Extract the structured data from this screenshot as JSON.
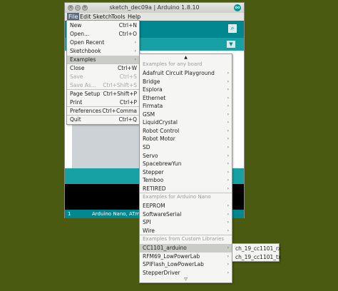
{
  "window": {
    "title": "sketch_dec09a | Arduino 1.8.10",
    "badge": "oo",
    "close_glyph": "×",
    "min_glyph": "-",
    "max_glyph": "+"
  },
  "menubar": [
    "File",
    "Edit",
    "Sketch",
    "Tools",
    "Help"
  ],
  "toolbar": {
    "serial_monitor_glyph": "⌕",
    "tab_menu_glyph": "▼"
  },
  "status": {
    "line": "1",
    "board": "Arduino Nano, ATmega..."
  },
  "file_menu": [
    {
      "label": "New",
      "shortcut": "Ctrl+N"
    },
    {
      "label": "Open...",
      "shortcut": "Ctrl+O"
    },
    {
      "label": "Open Recent",
      "arrow": "›"
    },
    {
      "label": "Sketchbook",
      "arrow": "›"
    },
    {
      "label": "Examples",
      "arrow": "›",
      "highlighted": true
    },
    {
      "label": "Close",
      "shortcut": "Ctrl+W"
    },
    {
      "label": "Save",
      "shortcut": "Ctrl+S",
      "disabled": true
    },
    {
      "label": "Save As...",
      "shortcut": "Ctrl+Shift+S",
      "disabled": true
    },
    {
      "label": "Page Setup",
      "shortcut": "Ctrl+Shift+P"
    },
    {
      "label": "Print",
      "shortcut": "Ctrl+P"
    },
    {
      "label": "Preferences",
      "shortcut": "Ctrl+Comma"
    },
    {
      "label": "Quit",
      "shortcut": "Ctrl+Q"
    }
  ],
  "examples_menu": {
    "scroll_up": "▲",
    "scroll_down": "▽",
    "header_any": "Examples for any board",
    "any_board": [
      "Adafruit Circuit Playground",
      "Bridge",
      "Esplora",
      "Ethernet",
      "Firmata",
      "GSM",
      "LiquidCrystal",
      "Robot Control",
      "Robot Motor",
      "SD",
      "Servo",
      "SpacebrewYun",
      "Stepper",
      "Temboo",
      "RETIRED"
    ],
    "header_nano": "Examples for Arduino Nano",
    "nano": [
      "EEPROM",
      "SoftwareSerial",
      "SPI",
      "Wire"
    ],
    "header_custom": "Examples from Custom Libraries",
    "custom": [
      "CC1101_arduino",
      "RFM69_LowPowerLab",
      "SPIFlash_LowPowerLab",
      "StepperDriver"
    ],
    "arrow": "›"
  },
  "cc1101_menu": [
    "ch_19_cc1101_rx",
    "ch_19_cc1101_tx"
  ]
}
